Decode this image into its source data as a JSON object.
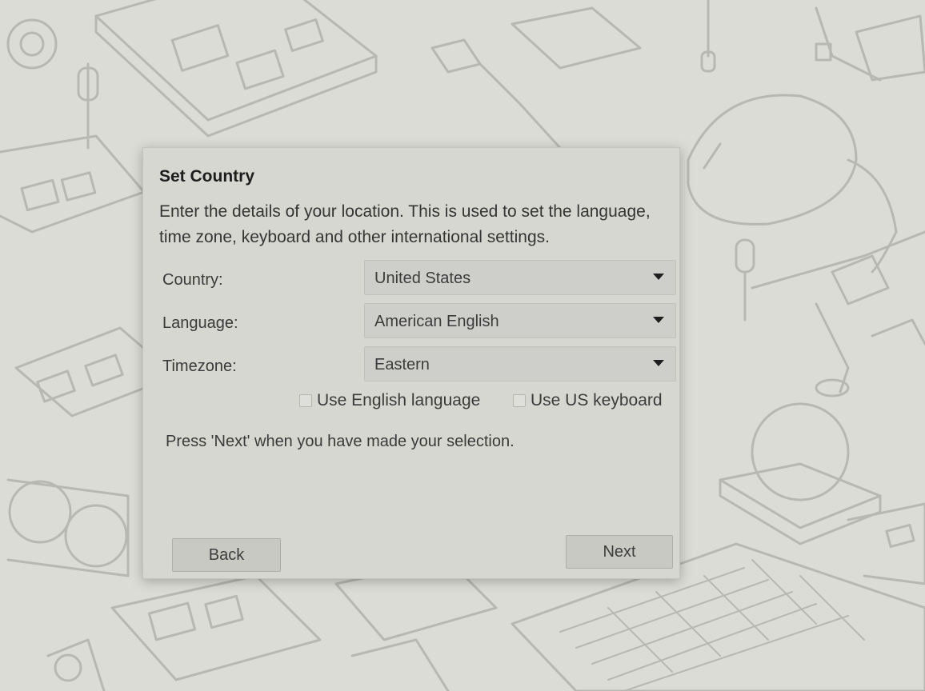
{
  "dialog": {
    "title": "Set Country",
    "description": "Enter the details of your location. This is used to set the language, time zone, keyboard and other international settings.",
    "fields": [
      {
        "label": "Country:",
        "value": "United States"
      },
      {
        "label": "Language:",
        "value": "American English"
      },
      {
        "label": "Timezone:",
        "value": "Eastern"
      }
    ],
    "checkboxes": [
      {
        "label": "Use English language",
        "checked": false
      },
      {
        "label": "Use US keyboard",
        "checked": false
      }
    ],
    "hint": "Press 'Next' when you have made your selection.",
    "back_label": "Back",
    "next_label": "Next"
  },
  "icons": {
    "dropdown": "triangle-down-icon",
    "checkbox": "checkbox-empty-icon"
  },
  "colors": {
    "dialog_bg": "#d7d7d1",
    "wallpaper_bg": "#dcdcd6",
    "wallpaper_line": "#b8b8b2"
  }
}
